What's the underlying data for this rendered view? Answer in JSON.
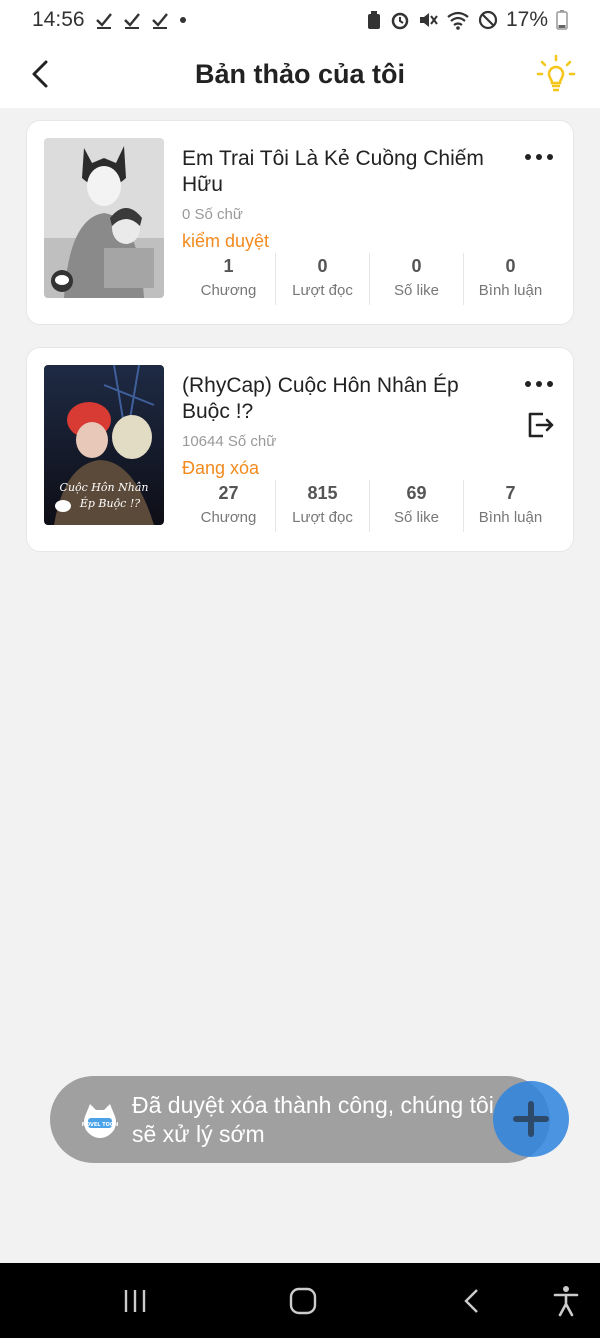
{
  "status_bar": {
    "time": "14:56",
    "battery": "17%",
    "icons": [
      "check-icon",
      "check-icon",
      "check-icon",
      "dot-icon",
      "storage-icon",
      "alarm-icon",
      "mute-icon",
      "wifi-icon",
      "block-icon",
      "battery-icon"
    ]
  },
  "header": {
    "title": "Bản thảo của tôi",
    "back_icon": "chevron-left-icon",
    "tip_icon": "lightbulb-icon",
    "tip_color": "#f5c518"
  },
  "drafts": [
    {
      "title": "Em Trai Tôi Là Kẻ Cuồng Chiếm Hữu",
      "word_count": "0 Số chữ",
      "status": "kiểm duyệt",
      "stats": [
        {
          "value": "1",
          "label": "Chương"
        },
        {
          "value": "0",
          "label": "Lượt đọc"
        },
        {
          "value": "0",
          "label": "Số like"
        },
        {
          "value": "0",
          "label": "Bình luận"
        }
      ]
    },
    {
      "title": "(RhyCap) Cuộc Hôn Nhân Ép Buộc !?",
      "word_count": "10644 Số chữ",
      "status": "Đang xóa",
      "cover_text": "Cuộc Hôn Nhân Ép Buộc !?",
      "stats": [
        {
          "value": "27",
          "label": "Chương"
        },
        {
          "value": "815",
          "label": "Lượt đọc"
        },
        {
          "value": "69",
          "label": "Số like"
        },
        {
          "value": "7",
          "label": "Bình luận"
        }
      ]
    }
  ],
  "toast": {
    "message": "Đã duyệt xóa thành công, chúng tôi sẽ xử lý sớm",
    "logo_text": "NOVEL TOON"
  },
  "colors": {
    "accent_orange": "#f28a1e",
    "fab_blue": "#2e84de",
    "background": "#f2f2f2"
  },
  "nav_bar": {
    "icons": [
      "recent-apps-icon",
      "home-icon",
      "back-icon",
      "accessibility-icon"
    ]
  }
}
